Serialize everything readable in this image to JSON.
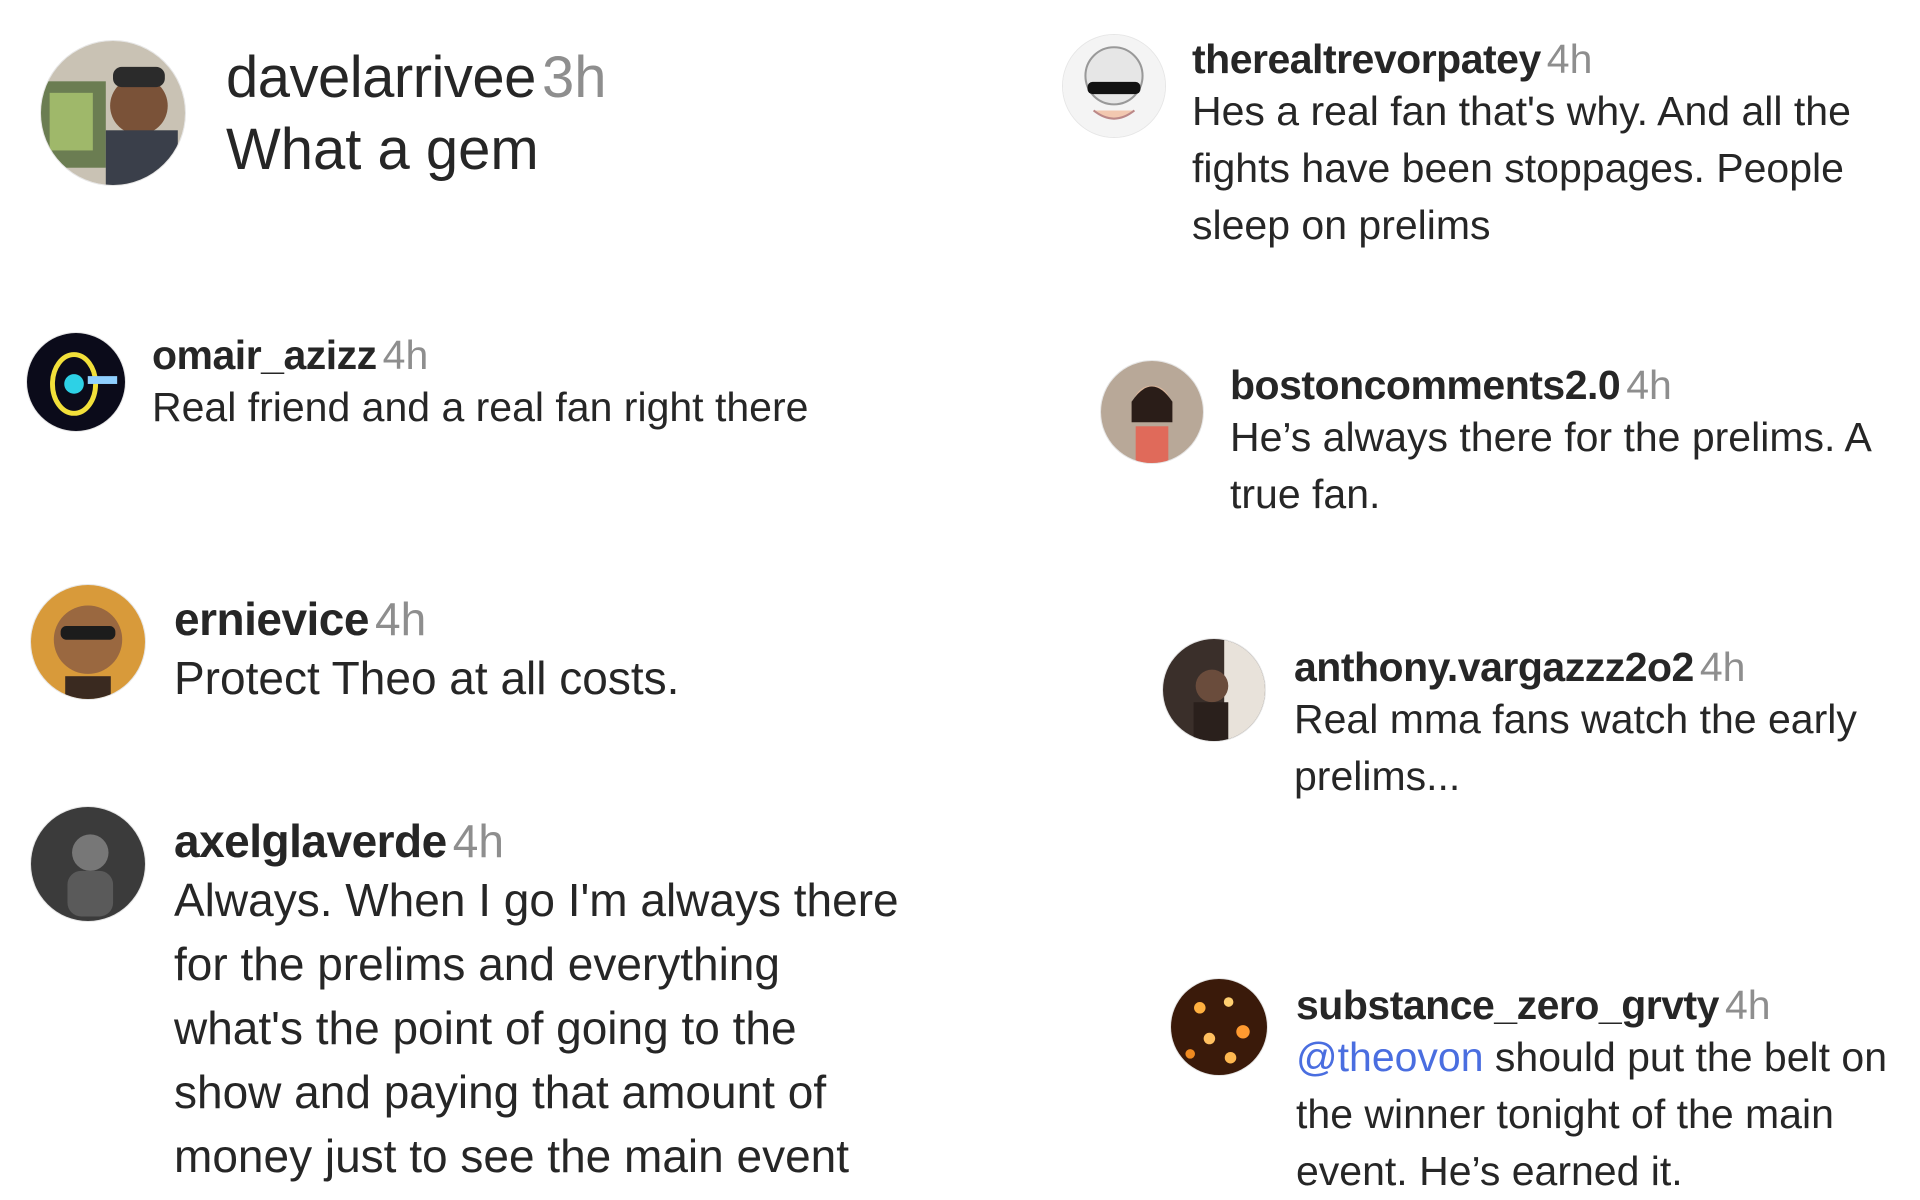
{
  "comments": {
    "c1": {
      "username": "davelarrivee",
      "time": "3h",
      "text": "What a gem",
      "avatar": "photo-man-with-cap"
    },
    "c2": {
      "username": "omair_azizz",
      "time": "4h",
      "text": "Real friend and a real fan right there",
      "avatar": "dark-logo"
    },
    "c3": {
      "username": "ernievice",
      "time": "4h",
      "text": "Protect Theo at all costs.",
      "avatar": "man-with-sunglasses"
    },
    "c4": {
      "username": "axelglaverde",
      "time": "4h",
      "lines": [
        "Always. When I go I'm always there",
        "for the prelims and everything",
        "what's the point of going to the",
        "show and paying that amount of",
        "money just to see the main event"
      ],
      "avatar": "dark-portrait"
    },
    "c5": {
      "username": "therealtrevorpatey",
      "time": "4h",
      "lines": [
        "Hes a real fan that's why. And all the",
        "fights have been stoppages. People",
        "sleep on prelims"
      ],
      "avatar": "cartoon-sunglasses"
    },
    "c6": {
      "username": "bostoncomments2.0",
      "time": "4h",
      "lines": [
        "He’s always there for the prelims. A",
        "true fan."
      ],
      "avatar": "woman-portrait"
    },
    "c7": {
      "username": "anthony.vargazzz2o2",
      "time": "4h",
      "lines": [
        "Real mma fans watch the early",
        "prelims..."
      ],
      "avatar": "dark-photo"
    },
    "c8": {
      "username": "substance_zero_grvty",
      "time": "4h",
      "mention": "@theovon",
      "line1_rest": " should put the belt on",
      "lines": [
        "the winner tonight of the main",
        "event. He’s earned it."
      ],
      "avatar": "orange-lights"
    }
  },
  "colors": {
    "text": "#262626",
    "timestamp": "#8e8e8e",
    "mention": "#4a6ee0"
  }
}
